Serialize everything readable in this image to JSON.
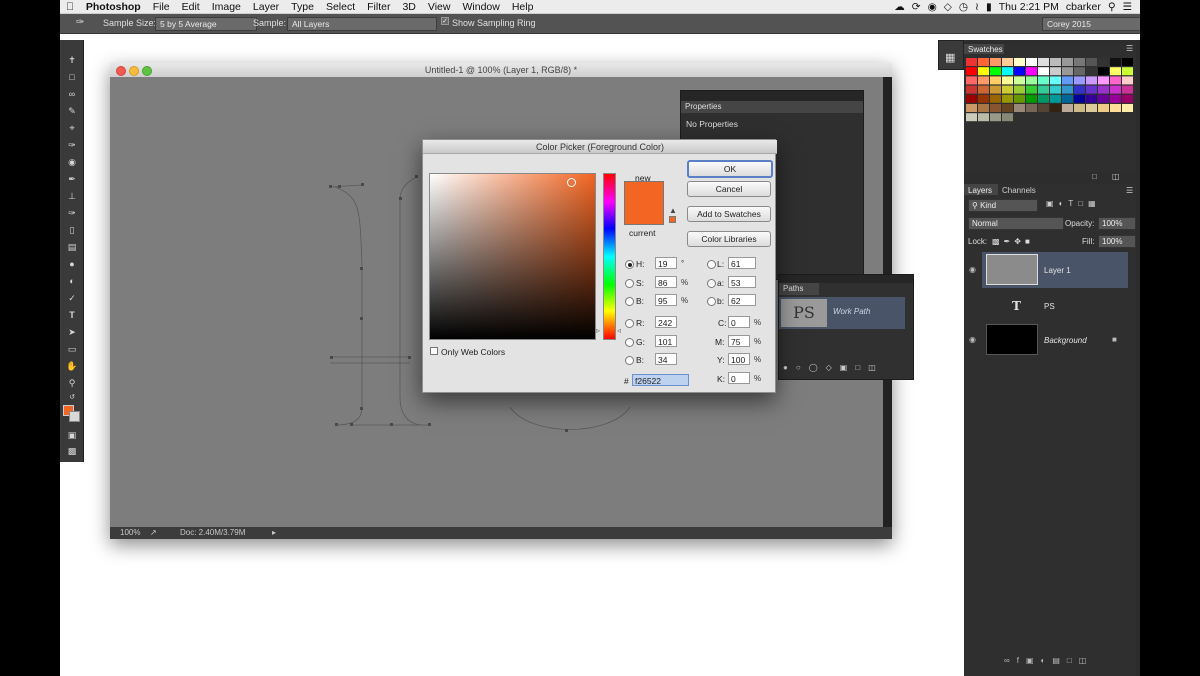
{
  "menubar": {
    "app": "Photoshop",
    "items": [
      "File",
      "Edit",
      "Image",
      "Layer",
      "Type",
      "Select",
      "Filter",
      "3D",
      "View",
      "Window",
      "Help"
    ],
    "clock": "Thu 2:21 PM",
    "user": "cbarker",
    "status_icons": [
      "creative-cloud-icon",
      "sync-icon",
      "notification-icon",
      "dropbox-icon",
      "time-machine-icon",
      "wifi-icon",
      "battery-icon"
    ]
  },
  "options_bar": {
    "sample_size_label": "Sample Size:",
    "sample_size_value": "5 by 5 Average",
    "sample_label": "Sample:",
    "sample_value": "All Layers",
    "show_ring_label": "Show Sampling Ring",
    "workspace": "Corey 2015"
  },
  "document": {
    "title": "Untitled-1 @ 100% (Layer 1, RGB/8) *",
    "zoom": "100%",
    "doc_size": "Doc: 2.40M/3.79M"
  },
  "properties": {
    "tab": "Properties",
    "message": "No Properties"
  },
  "paths_panel": {
    "tab": "Paths",
    "item": "Work Path",
    "thumb_text": "PS"
  },
  "color_picker": {
    "title": "Color Picker (Foreground Color)",
    "new_label": "new",
    "current_label": "current",
    "new_color": "#f26522",
    "current_color": "#f26522",
    "buttons": {
      "ok": "OK",
      "cancel": "Cancel",
      "add_swatches": "Add to Swatches",
      "libraries": "Color Libraries"
    },
    "only_web_colors": "Only Web Colors",
    "hsb": {
      "h_label": "H:",
      "h": "19",
      "h_unit": "°",
      "s_label": "S:",
      "s": "86",
      "s_unit": "%",
      "b_label": "B:",
      "b": "95",
      "b_unit": "%"
    },
    "rgb": {
      "r_label": "R:",
      "r": "242",
      "g_label": "G:",
      "g": "101",
      "b_label": "B:",
      "b": "34"
    },
    "lab": {
      "l_label": "L:",
      "l": "61",
      "a_label": "a:",
      "a": "53",
      "b_label": "b:",
      "b": "62"
    },
    "cmyk": {
      "c_label": "C:",
      "c": "0",
      "m_label": "M:",
      "m": "75",
      "y_label": "Y:",
      "y": "100",
      "k_label": "K:",
      "k": "0",
      "unit": "%"
    },
    "hex_label": "#",
    "hex": "f26522"
  },
  "swatches": {
    "tab": "Swatches"
  },
  "layers": {
    "tabs": [
      "Layers",
      "Channels"
    ],
    "filter": "Kind",
    "blend": "Normal",
    "opacity_label": "Opacity:",
    "opacity": "100%",
    "lock_label": "Lock:",
    "fill_label": "Fill:",
    "fill": "100%",
    "items": [
      {
        "name": "Layer 1"
      },
      {
        "name": "PS",
        "type_glyph": "T"
      },
      {
        "name": "Background"
      }
    ]
  },
  "colors": {
    "foreground": "#f26522",
    "ui_dark": "#2f2f2f",
    "selected_row": "#4a5468"
  }
}
